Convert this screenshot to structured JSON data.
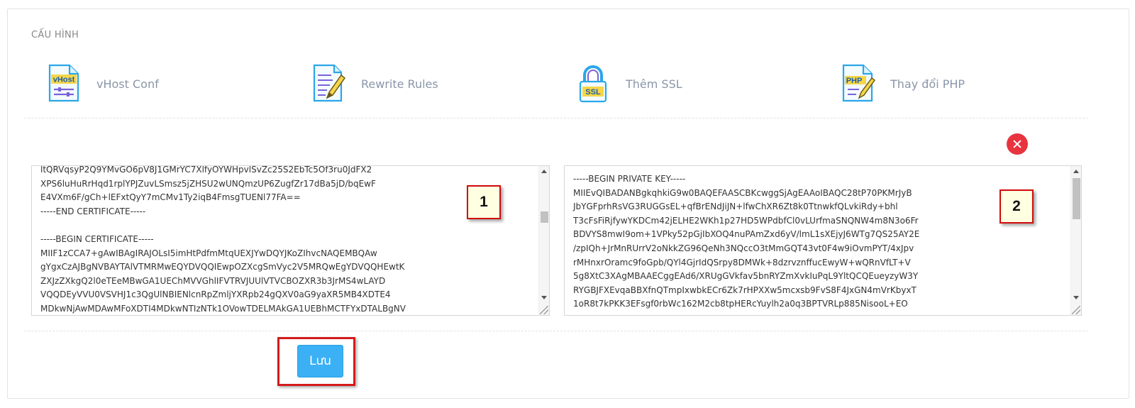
{
  "section": {
    "title": "CẤU HÌNH"
  },
  "tools": [
    {
      "label": "vHost Conf",
      "icon": "vhost-file-icon",
      "icon_text": "vHost"
    },
    {
      "label": "Rewrite Rules",
      "icon": "document-pencil-icon"
    },
    {
      "label": "Thêm SSL",
      "icon": "padlock-icon",
      "icon_text": "SSL"
    },
    {
      "label": "Thay đổi PHP",
      "icon": "php-file-icon",
      "icon_text": "PHP"
    }
  ],
  "certificate": {
    "content": "ltQRVqsyP2Q9YMvGO6pV8J1GMrYC7XlfyOYWHpvlSvZc25S2EbTc5Of3ru0JdFX2\nXPS6luHuRrHqd1rplYPJZuvLSmsz5jZHSU2wUNQmzUP6ZugfZr17dBa5jD/bqEwF\nE4VXm6F/gCh+lEFxtQyY7mCMv1Ty2iqB4FmsgTUENl77FA==\n-----END CERTIFICATE-----\n\n-----BEGIN CERTIFICATE-----\nMIIF1zCCA7+gAwIBAgIRAJOLsI5imHtPdfmMtqUEXJYwDQYJKoZIhvcNAQEMBQAw\ngYgxCzAJBgNVBAYTAlVTMRMwEQYDVQQIEwpOZXcgSmVyc2V5MRQwEgYDVQQHEwtK\nZXJzZXkgQ2l0eTEeMBwGA1UEChMVVGhlIFVTRVJUUlVTVCBOZXR3b3JrMS4wLAYD\nVQQDEyVVU0VSVHJ1c3QgUlNBIENlcnRpZmljYXRpb24gQXV0aG9yaXR5MB4XDTE4\nMDkwNjAwMDAwMFoXDTI4MDkwNTIzNTk1OVowTDELMAkGA1UEBhMCTFYxDTALBgNV",
    "marker": "1"
  },
  "private_key": {
    "content": "-----BEGIN PRIVATE KEY-----\nMIIEvQIBADANBgkqhkiG9w0BAQEFAASCBKcwggSjAgEAAoIBAQC28tP70PKMrJyB\nJbYGFprhRsVG3RUGGsEL+qfBrENdJiJN+lfwChXR6Zt8k0TtnwkfQLvkiRdy+bhl\nT3cFsFiRjfywYKDCm42jELHE2WKh1p27HD5WPdbfCl0vLUrfmaSNQNW4m8N3o6Fr\nBDVYS8mwI9om+1VPky52pGjIbXOQ4nuPAmZxd6yV/lmL1sXEjyJ6WTg7QS25AY2E\n/zpIQh+JrMnRUrrV2oNkkZG96QeNh3NQccO3tMmGQT43vt0F4w9iOvmPYT/4xJpv\nrMHnxrOramc9foGpb/QYl4GjrIdQSrpy8DMWk+8dzrvznffucEwyW+wQRnVfLT+V\n5g8XtC3XAgMBAAECggEAd6/XRUgGVkfav5bnRYZmXvkIuPqL9YltQCQEueyzyW3Y\nRYGBJFXEvqaBBXfnQTmpIxwbkECr6Zk7rHPXXw5mcxsb9FvS8F4JxGN4mVrKbyxT\n1oR8t7kPKK3EFsgf0rbWc162M2cb8tpHERcYuylh2a0q3BPTVRLp885NisooL+EO",
    "marker": "2"
  },
  "actions": {
    "save_label": "Lưu"
  },
  "colors": {
    "accent": "#3bb0f5",
    "danger": "#e8343f",
    "annotation": "#d10a0a"
  }
}
